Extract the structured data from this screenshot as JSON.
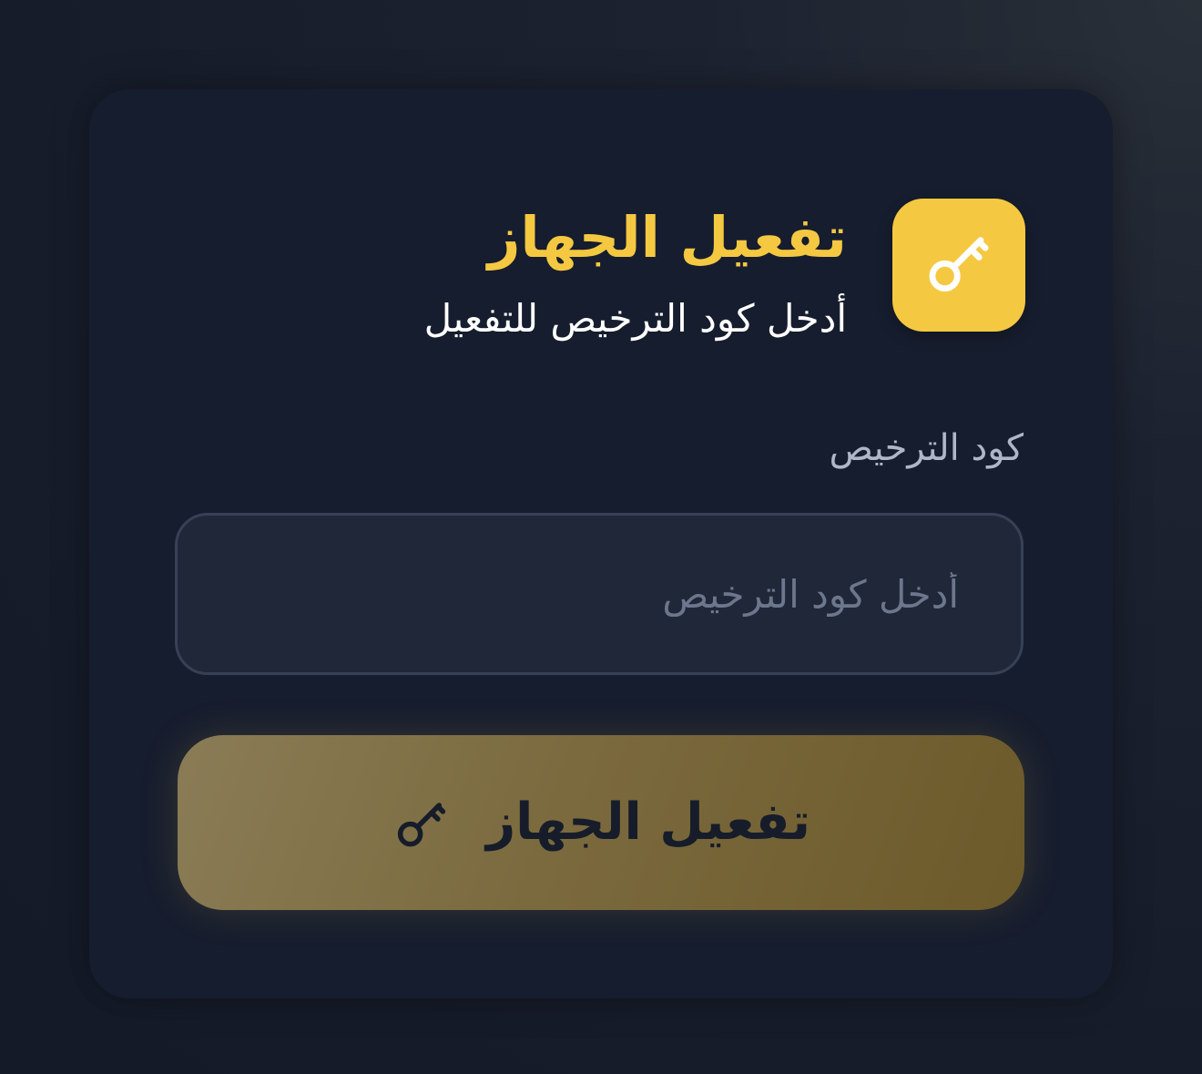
{
  "card": {
    "title": "تفعيل الجهاز",
    "subtitle": "أدخل كود الترخيص للتفعيل",
    "icon": "key-icon"
  },
  "form": {
    "license_label": "كود الترخيص",
    "license_placeholder": "أدخل كود الترخيص",
    "license_value": ""
  },
  "button": {
    "label": "تفعيل الجهاز",
    "icon": "key-icon"
  },
  "colors": {
    "accent": "#f5c842",
    "background": "#161c2a",
    "card": "#161d2e",
    "input_bg": "#1f2739",
    "button_bg": "#7b6a3e"
  }
}
